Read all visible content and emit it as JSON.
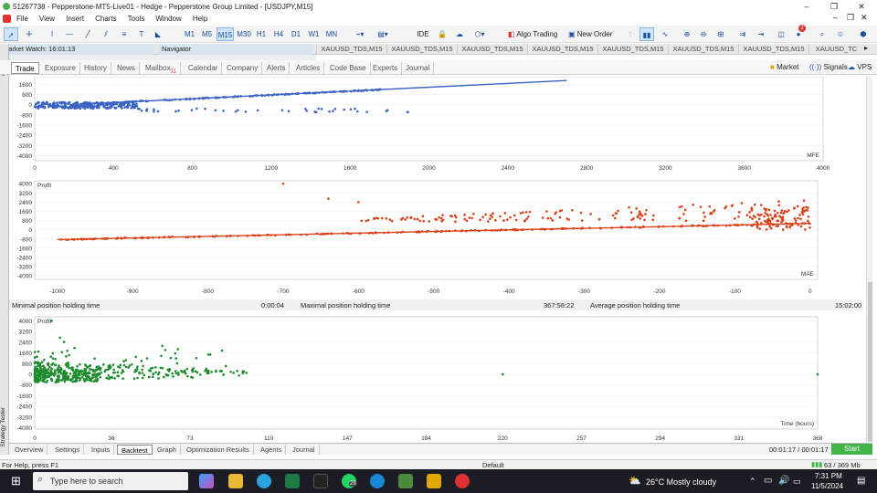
{
  "window": {
    "title": "51267738 - Pepperstone-MT5-Live01 - Hedge - Pepperstone Group Limited - [USDJPY,M15]"
  },
  "menu": [
    "File",
    "View",
    "Insert",
    "Charts",
    "Tools",
    "Window",
    "Help"
  ],
  "toolbar": {
    "timeframes": [
      "M1",
      "M5",
      "M15",
      "M30",
      "H1",
      "H4",
      "D1",
      "W1",
      "MN"
    ],
    "selected_timeframe": "M15",
    "ide_label": "IDE",
    "algo_trading_label": "Algo Trading",
    "new_order_label": "New Order",
    "notification_count": "2"
  },
  "pane_headers": {
    "market_watch": "Market Watch: 16:01:13",
    "navigator": "Navigator"
  },
  "chart_tabs": [
    "XAUUSD_TDS,M15",
    "XAUUSD_TDS,M15",
    "XAUUSD_TDS,M15",
    "XAUUSD_TDS,M15",
    "XAUUSD_TDS,M15",
    "XAUUSD_TDS,M15",
    "XAUUSD_TDS,M15",
    "XAUUSD_TDS,M15",
    "XAUUSD_TC"
  ],
  "toolbox_tabs": [
    {
      "label": "Trade"
    },
    {
      "label": "Exposure"
    },
    {
      "label": "History"
    },
    {
      "label": "News"
    },
    {
      "label": "Mailbox",
      "badge": "11"
    },
    {
      "label": "Calendar"
    },
    {
      "label": "Company"
    },
    {
      "label": "Alerts"
    },
    {
      "label": "Articles"
    },
    {
      "label": "Code Base"
    },
    {
      "label": "Experts"
    },
    {
      "label": "Journal"
    }
  ],
  "toolbox_right": {
    "market": "Market",
    "signals": "Signals",
    "vps": "VPS"
  },
  "colors": {
    "mfe": "#3a63c4",
    "mae": "#d8401a",
    "holding": "#1e8c2e",
    "start": "#3fb54a"
  },
  "chart_data": [
    {
      "type": "scatter",
      "xlabel": "MFE",
      "x_ticks": [
        0,
        400,
        800,
        1200,
        1600,
        2000,
        2400,
        2800,
        3200,
        3600,
        4000
      ],
      "y_ticks": [
        1600,
        800,
        0,
        -800,
        -1600,
        -2400,
        -3200,
        -4000
      ],
      "xlim": [
        0,
        4000
      ],
      "ylim": [
        -4400,
        2200
      ],
      "trend": [
        [
          180,
          0
        ],
        [
          2700,
          1900
        ]
      ],
      "series_color": "#3a63c4"
    },
    {
      "type": "scatter",
      "ylabel": "Profit",
      "xlabel": "MAE",
      "x_ticks": [
        -1000,
        -900,
        -800,
        -700,
        -600,
        -500,
        -400,
        -300,
        -200,
        -100,
        0
      ],
      "y_ticks": [
        4000,
        3200,
        2400,
        1600,
        800,
        0,
        -800,
        -1600,
        -2400,
        -3200,
        -4000
      ],
      "xlim": [
        -1030,
        10
      ],
      "ylim": [
        -4300,
        4250
      ],
      "trend": [
        [
          -1000,
          -850
        ],
        [
          0,
          550
        ]
      ],
      "series_color": "#d8401a"
    },
    {
      "type": "scatter",
      "ylabel": "Profit",
      "xlabel": "Time (hours)",
      "x_ticks": [
        0,
        36,
        73,
        110,
        147,
        184,
        220,
        257,
        294,
        331,
        368
      ],
      "y_ticks": [
        4000,
        3200,
        2400,
        1600,
        800,
        0,
        -800,
        -1600,
        -2400,
        -3200,
        -4000
      ],
      "xlim": [
        0,
        368
      ],
      "ylim": [
        -4100,
        4300
      ],
      "series_color": "#1e8c2e"
    }
  ],
  "stats": {
    "min_label": "Minimal position holding time",
    "min_value": "0:00:04",
    "max_label": "Maximal position holding time",
    "max_value": "367:56:22",
    "avg_label": "Average position holding time",
    "avg_value": "15:02:00"
  },
  "bottom_tabs": [
    "Overview",
    "Settings",
    "Inputs",
    "Backtest",
    "Graph",
    "Optimization Results",
    "Agents",
    "Journal"
  ],
  "selected_bottom_tab": "Backtest",
  "timer": "00:01:17 / 00:01:17",
  "start_label": "Start",
  "strategy_tester_label": "Strategy Tester",
  "status": {
    "help": "For Help, press F1",
    "profile": "Default",
    "memory": "63 / 369 Mb"
  },
  "taskbar": {
    "search_placeholder": "Type here to search",
    "whatsapp_badge": "29",
    "weather": "26°C  Mostly cloudy",
    "time": "7:31 PM",
    "date": "11/5/2024"
  }
}
